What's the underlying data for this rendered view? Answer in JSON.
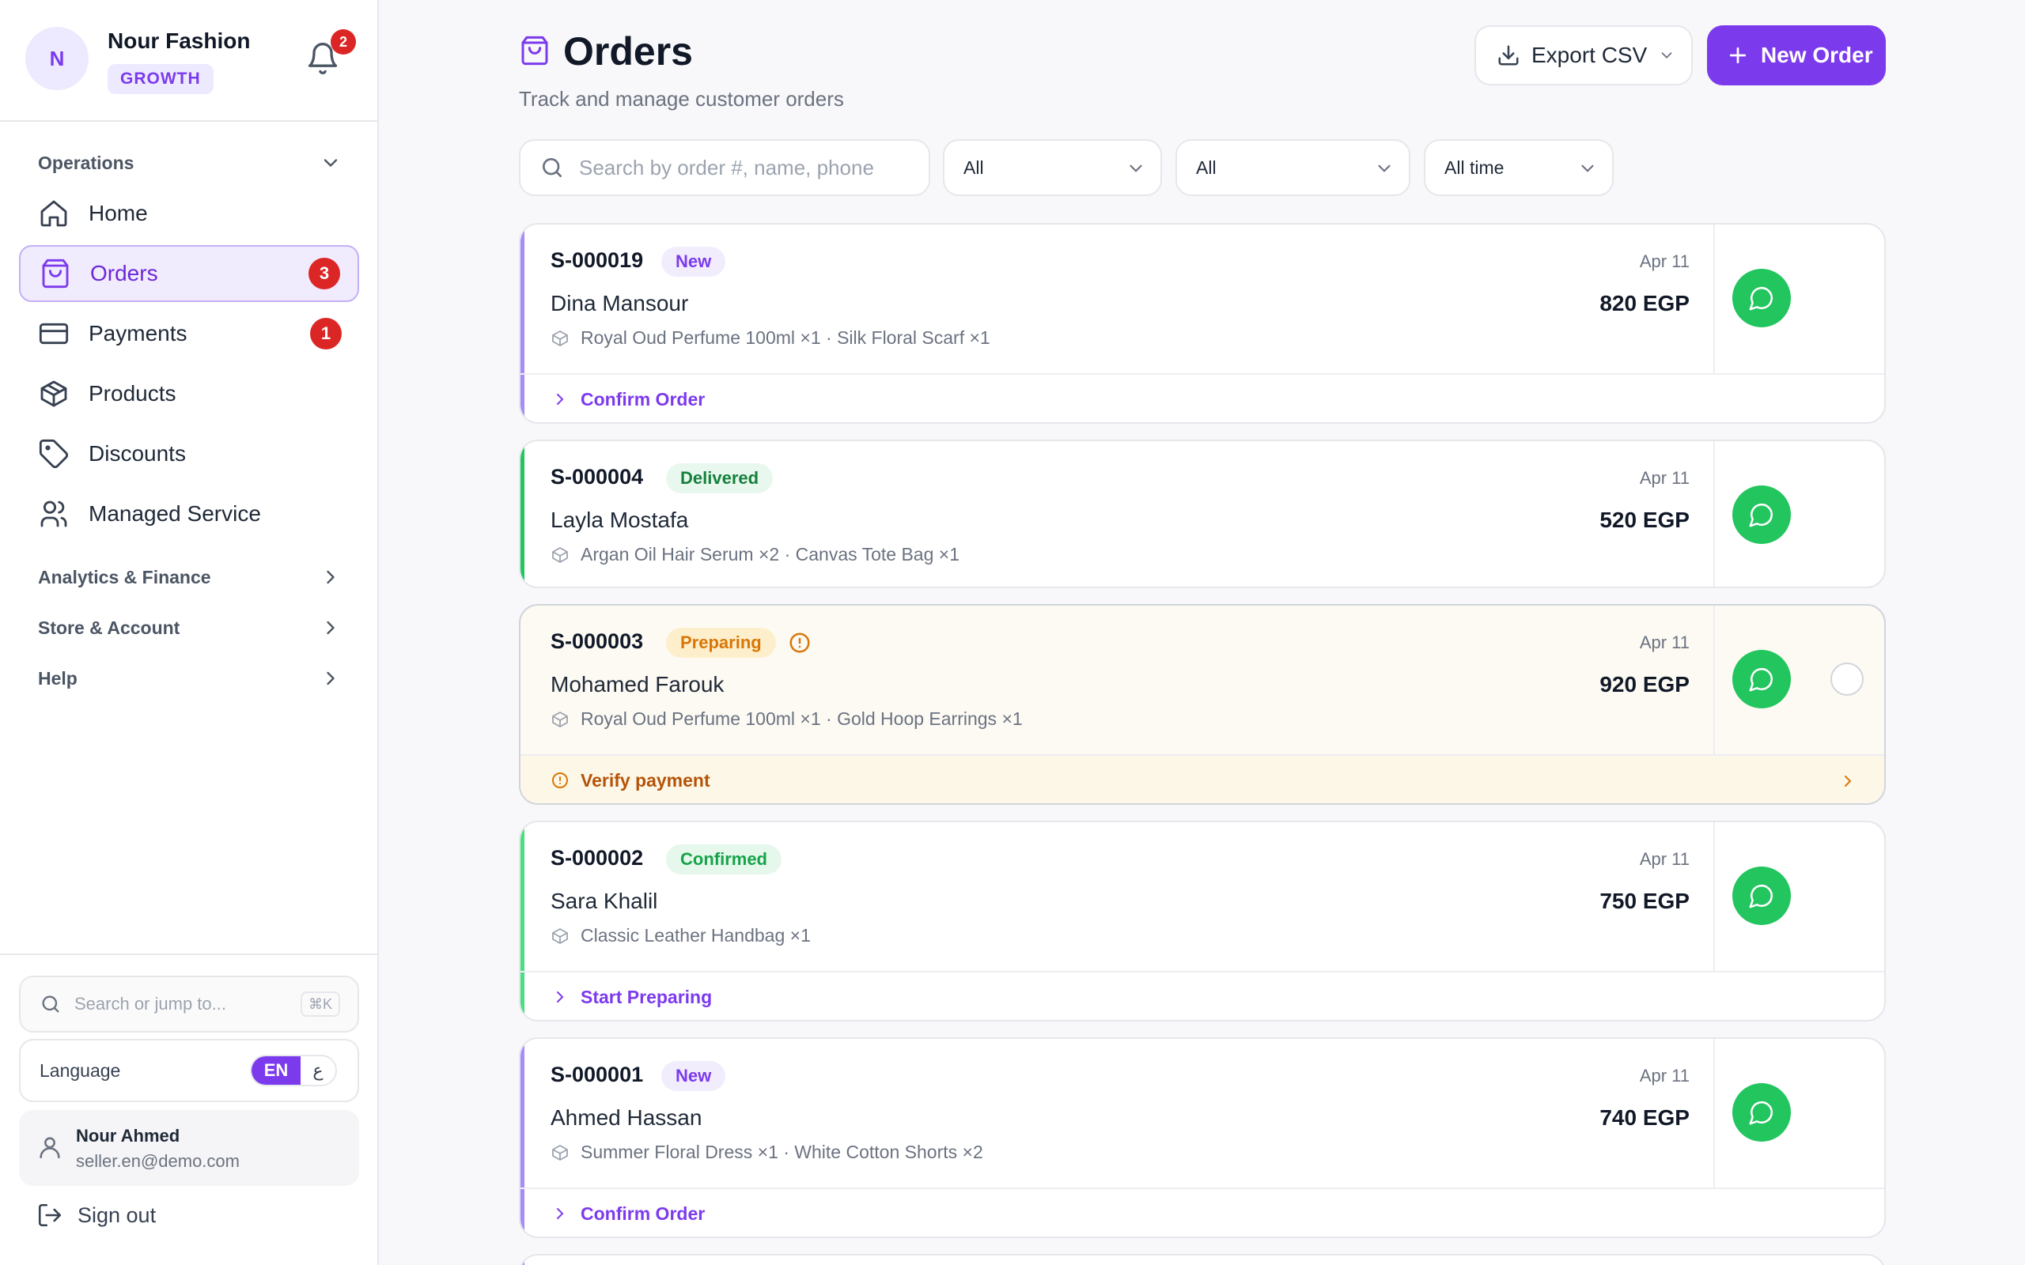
{
  "store": {
    "initial": "N",
    "name": "Nour Fashion",
    "plan": "GROWTH",
    "notifications": "2"
  },
  "sidebar": {
    "sections": [
      {
        "label": "Operations"
      },
      {
        "label": "Analytics & Finance"
      },
      {
        "label": "Store & Account"
      },
      {
        "label": "Help"
      }
    ],
    "items": [
      {
        "label": "Home",
        "icon": "home-icon"
      },
      {
        "label": "Orders",
        "icon": "shopping-bag-icon",
        "badge": "3",
        "active": true
      },
      {
        "label": "Payments",
        "icon": "credit-card-icon",
        "badge": "1"
      },
      {
        "label": "Products",
        "icon": "box-icon"
      },
      {
        "label": "Discounts",
        "icon": "tag-icon"
      },
      {
        "label": "Managed Service",
        "icon": "users-icon"
      }
    ],
    "jump_placeholder": "Search or jump to...",
    "jump_shortcut": "⌘K",
    "language_label": "Language",
    "lang_en": "EN",
    "lang_ar": "ع",
    "user_name": "Nour Ahmed",
    "user_email": "seller.en@demo.com",
    "signout": "Sign out"
  },
  "header": {
    "title": "Orders",
    "subtitle": "Track and manage customer orders",
    "export_label": "Export CSV",
    "new_order_label": "New Order"
  },
  "filters": {
    "search_placeholder": "Search by order #, name, phone",
    "status": "All",
    "payment": "All",
    "period": "All time"
  },
  "orders": [
    {
      "number": "S-000019",
      "status": "New",
      "customer": "Dina Mansour",
      "items": "Royal Oud Perfume 100ml ×1 · Silk Floral Scarf ×1",
      "date": "Apr 11",
      "amount": "820 EGP",
      "action": "Confirm Order"
    },
    {
      "number": "S-000004",
      "status": "Delivered",
      "customer": "Layla Mostafa",
      "items": "Argan Oil Hair Serum ×2 · Canvas Tote Bag ×1",
      "date": "Apr 11",
      "amount": "520 EGP"
    },
    {
      "number": "S-000003",
      "status": "Preparing",
      "customer": "Mohamed Farouk",
      "items": "Royal Oud Perfume 100ml ×1 · Gold Hoop Earrings ×1",
      "date": "Apr 11",
      "amount": "920 EGP",
      "action": "Verify payment"
    },
    {
      "number": "S-000002",
      "status": "Confirmed",
      "customer": "Sara Khalil",
      "items": "Classic Leather Handbag ×1",
      "date": "Apr 11",
      "amount": "750 EGP",
      "action": "Start Preparing"
    },
    {
      "number": "S-000001",
      "status": "New",
      "customer": "Ahmed Hassan",
      "items": "Summer Floral Dress ×1 · White Cotton Shorts ×2",
      "date": "Apr 11",
      "amount": "740 EGP",
      "action": "Confirm Order"
    }
  ],
  "colors": {
    "accent": "#7c3aed",
    "new": "#7c3aed",
    "delivered": "#22c55e",
    "preparing": "#d97706",
    "confirmed": "#22c55e",
    "whatsapp": "#22c55e",
    "badge": "#dc2626"
  }
}
